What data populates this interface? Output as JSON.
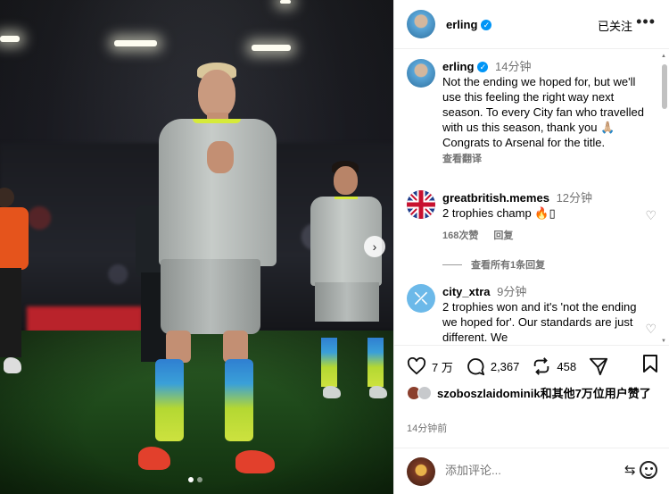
{
  "post": {
    "author": "erling",
    "follow_label": "已关注",
    "more_label": "•••",
    "caption": "Not the ending we hoped for, but we'll use this feeling the right way next season. To every City fan who travelled with us this season, thank you 🙏🏼 Congrats to Arsenal for the title.",
    "caption_time": "14分钟",
    "translate_label": "查看翻译",
    "carousel": {
      "next_label": "›",
      "active_slide": 1,
      "slide_count": 2
    }
  },
  "comments": [
    {
      "username": "greatbritish.memes",
      "time": "12分钟",
      "text": "2 trophies champ 🔥▯",
      "likes": "168次赞",
      "reply_label": "回复",
      "view_replies": "查看所有1条回复"
    },
    {
      "username": "city_xtra",
      "time": "9分钟",
      "text": "2 trophies won and it's 'not the ending we hoped for'. Our standards are just different. We",
      "avatar_letter": "⤫"
    }
  ],
  "actions": {
    "like_count": "7 万",
    "comment_count": "2,367",
    "share_count": "458",
    "liked_by_user": "szoboszlaidominik",
    "liked_by_suffix": "和其他7万位用户赞了",
    "post_time": "14分钟前",
    "comment_placeholder": "添加评论..."
  },
  "colors": {
    "verified": "#0095f6",
    "secondary_text": "#737373",
    "divider": "#efefef"
  },
  "icons": [
    "heart-icon",
    "comment-icon",
    "repost-icon",
    "share-icon",
    "bookmark-icon",
    "emoji-icon",
    "gif-icon",
    "verified-icon",
    "more-icon",
    "chevron-right-icon"
  ]
}
